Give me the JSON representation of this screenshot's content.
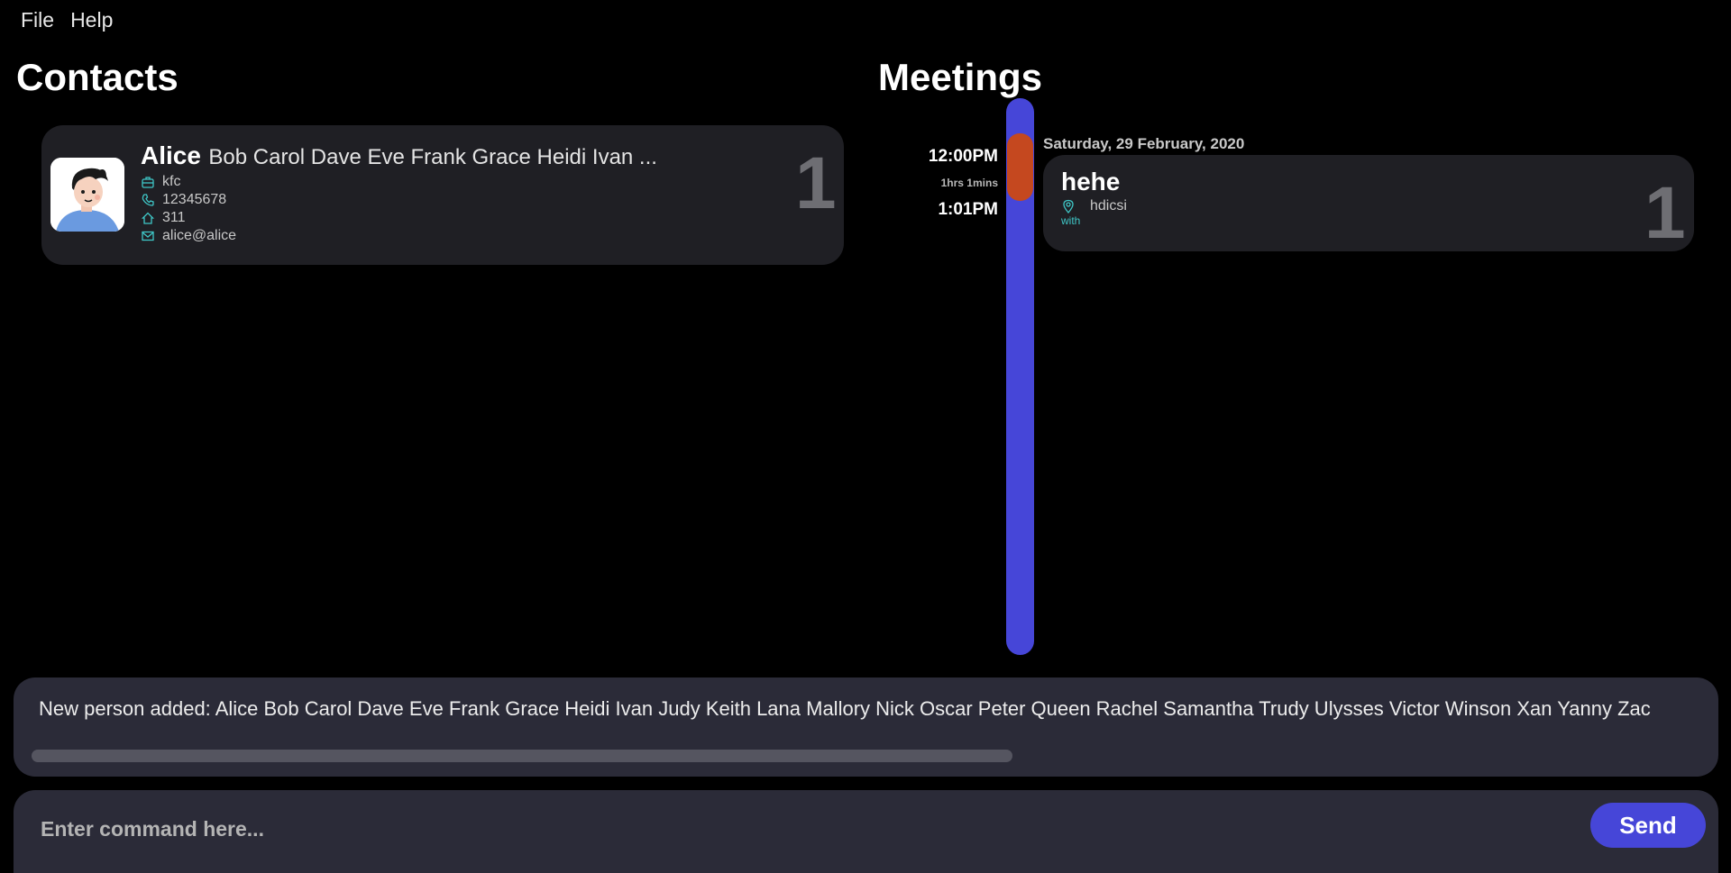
{
  "menubar": {
    "items": [
      "File",
      "Help"
    ]
  },
  "contacts": {
    "title": "Contacts",
    "cards": [
      {
        "index": "1",
        "first_name": "Alice",
        "rest_name": "Bob Carol Dave Eve Frank Grace Heidi Ivan ...",
        "company": "kfc",
        "phone": "12345678",
        "address": "311",
        "email": "alice@alice"
      }
    ]
  },
  "meetings": {
    "title": "Meetings",
    "date": "Saturday, 29 February, 2020",
    "start_time": "12:00PM",
    "duration": "1hrs 1mins",
    "end_time": "1:01PM",
    "items": [
      {
        "index": "1",
        "title": "hehe",
        "location": "hdicsi",
        "with_label": "with"
      }
    ]
  },
  "result": {
    "text": "New person added: Alice Bob Carol Dave Eve Frank Grace Heidi Ivan Judy Keith Lana Mallory Nick Oscar Peter Queen Rachel Samantha Trudy Ulysses Victor Winson Xan Yanny Zac"
  },
  "command": {
    "placeholder": "Enter command here...",
    "value": "",
    "send_label": "Send"
  },
  "colors": {
    "accent": "#4646d8",
    "event": "#c5481f",
    "icon": "#3fc7c7",
    "card": "#1f1f24",
    "panel": "#2b2b38"
  },
  "icons": {
    "company": "briefcase-icon",
    "phone": "phone-icon",
    "address": "home-icon",
    "email": "envelope-icon",
    "location": "location-pin-icon"
  }
}
